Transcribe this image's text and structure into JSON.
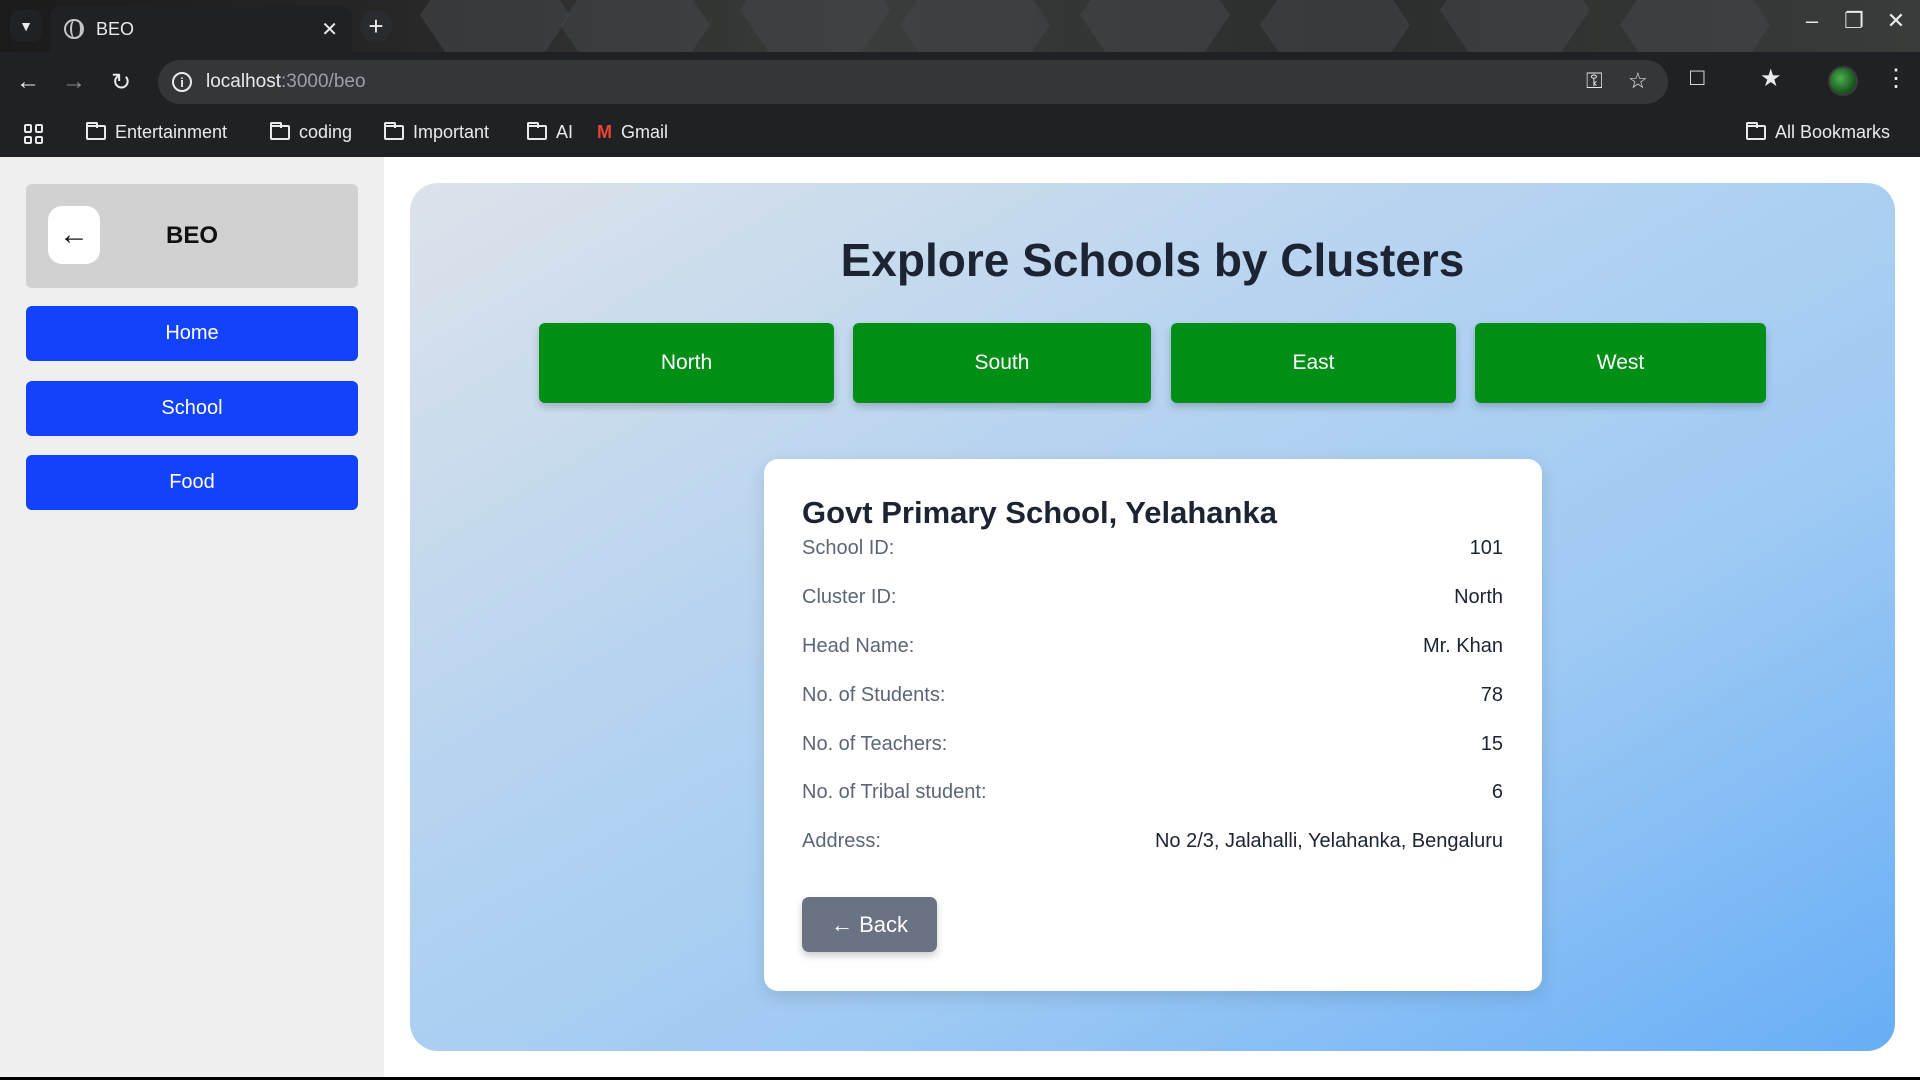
{
  "browser": {
    "tab_title": "BEO",
    "url_host": "localhost",
    "url_path": ":3000/beo",
    "bookmarks": [
      {
        "label": "Entertainment",
        "icon": "folder-icon"
      },
      {
        "label": "coding",
        "icon": "folder-icon"
      },
      {
        "label": "Important",
        "icon": "folder-icon"
      },
      {
        "label": "AI",
        "icon": "folder-icon"
      },
      {
        "label": "Gmail",
        "icon": "gmail-icon"
      }
    ],
    "all_bookmarks": "All Bookmarks"
  },
  "sidebar": {
    "title": "BEO",
    "back_icon": "←",
    "items": [
      {
        "label": "Home"
      },
      {
        "label": "School"
      },
      {
        "label": "Food"
      }
    ]
  },
  "main": {
    "title": "Explore Schools by Clusters",
    "clusters": [
      {
        "label": "North"
      },
      {
        "label": "South"
      },
      {
        "label": "East"
      },
      {
        "label": "West"
      }
    ]
  },
  "school": {
    "name": "Govt Primary School, Yelahanka",
    "fields": [
      {
        "label": "School ID:",
        "value": "101"
      },
      {
        "label": "Cluster ID:",
        "value": "North"
      },
      {
        "label": "Head Name:",
        "value": "Mr. Khan"
      },
      {
        "label": "No. of Students:",
        "value": "78"
      },
      {
        "label": "No. of Teachers:",
        "value": "15"
      },
      {
        "label": "No. of Tribal student:",
        "value": "6"
      },
      {
        "label": "Address:",
        "value": "No 2/3, Jalahalli, Yelahanka, Bengaluru"
      }
    ],
    "back_label": "← Back"
  },
  "colors": {
    "nav_button": "#1342fd",
    "cluster_button": "#008f16",
    "back_button": "#6a7383"
  }
}
